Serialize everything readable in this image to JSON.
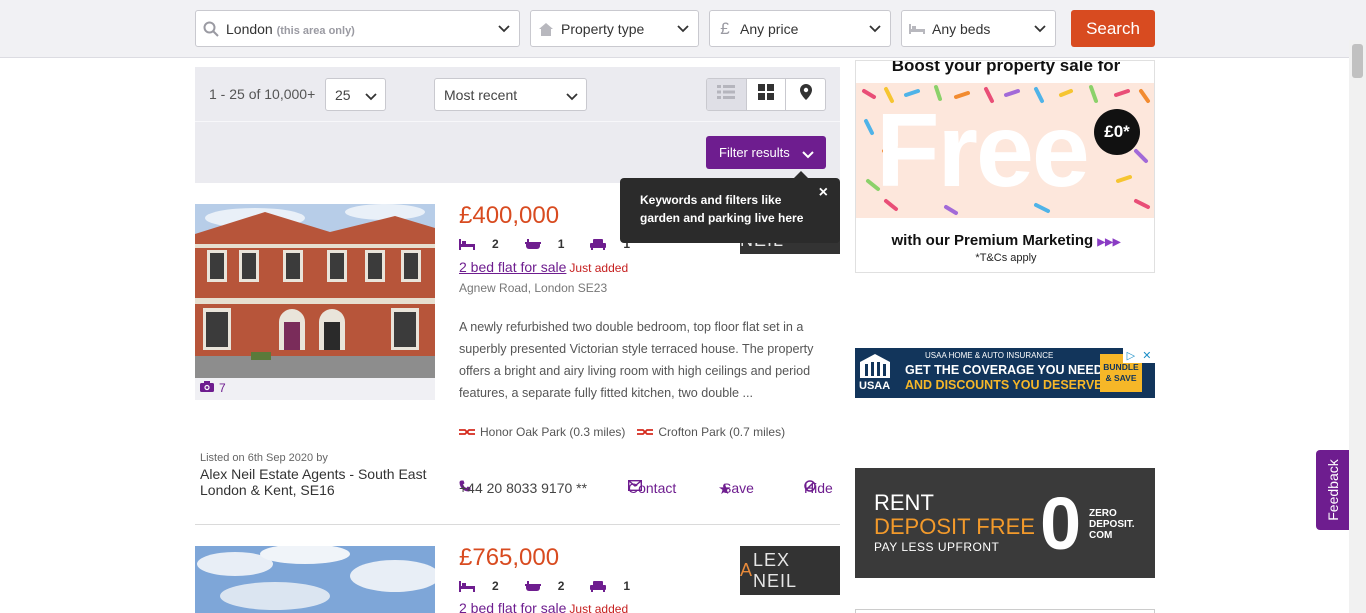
{
  "search": {
    "location": "London",
    "location_hint": "(this area only)",
    "property_type": "Property type",
    "price": "Any price",
    "beds": "Any beds",
    "search_label": "Search"
  },
  "results": {
    "count_text": "1 - 25 of 10,000+",
    "per_page": "25",
    "sort": "Most recent",
    "filter_label": "Filter results",
    "tooltip_text": "Keywords and filters like garden and parking live here",
    "tooltip_close": "×"
  },
  "listings": [
    {
      "price": "£400,000",
      "beds": "2",
      "baths": "1",
      "receptions": "1",
      "title": "2 bed flat for sale",
      "badge": "Just added",
      "address": "Agnew Road, London SE23",
      "description": "A newly refurbished two double bedroom, top floor flat set in a superbly presented Victorian style terraced house. The property offers a bright and airy living room with high ceilings and period features, a separate fully fitted kitchen, two double ...",
      "stations": [
        "Honor Oak Park (0.3 miles)",
        "Crofton Park (0.7 miles)"
      ],
      "listed": "Listed on 6th Sep 2020 by",
      "agent": "Alex Neil Estate Agents - South East London & Kent, SE16",
      "phone": "+44 20 8033 9170 **",
      "contact": "Contact",
      "save": "Save",
      "hide": "Hide",
      "photo_count": "7",
      "logo_text": "ALEX NEIL"
    },
    {
      "price": "£765,000",
      "beds": "2",
      "baths": "2",
      "receptions": "1",
      "title": "2 bed flat for sale",
      "badge": "Just added",
      "logo_a": "A",
      "logo_text": "LEX NEIL"
    }
  ],
  "ads": {
    "free": {
      "top": "Boost your property sale for",
      "big": "Free",
      "badge": "£0*",
      "line": "with our Premium Marketing",
      "arrows": "▶▶▶",
      "tc": "*T&Cs apply"
    },
    "usaa": {
      "brand": "USAA",
      "top": "USAA HOME & AUTO INSURANCE",
      "line1": "GET THE COVERAGE YOU NEED",
      "line2": "AND DISCOUNTS YOU DESERVE",
      "cta": "BUNDLE & SAVE"
    },
    "zero": {
      "rent": "RENT",
      "deposit": "DEPOSIT FREE",
      "sub": "PAY LESS UPFRONT",
      "digit": "0",
      "brand1": "ZERO",
      "brand2": "DEPOSIT.",
      "brand3": "COM"
    }
  },
  "feedback_label": "Feedback",
  "colors": {
    "accent": "#6e1d8f",
    "price": "#d84b20",
    "search_button": "#d84b20",
    "just_added": "#c62020"
  }
}
